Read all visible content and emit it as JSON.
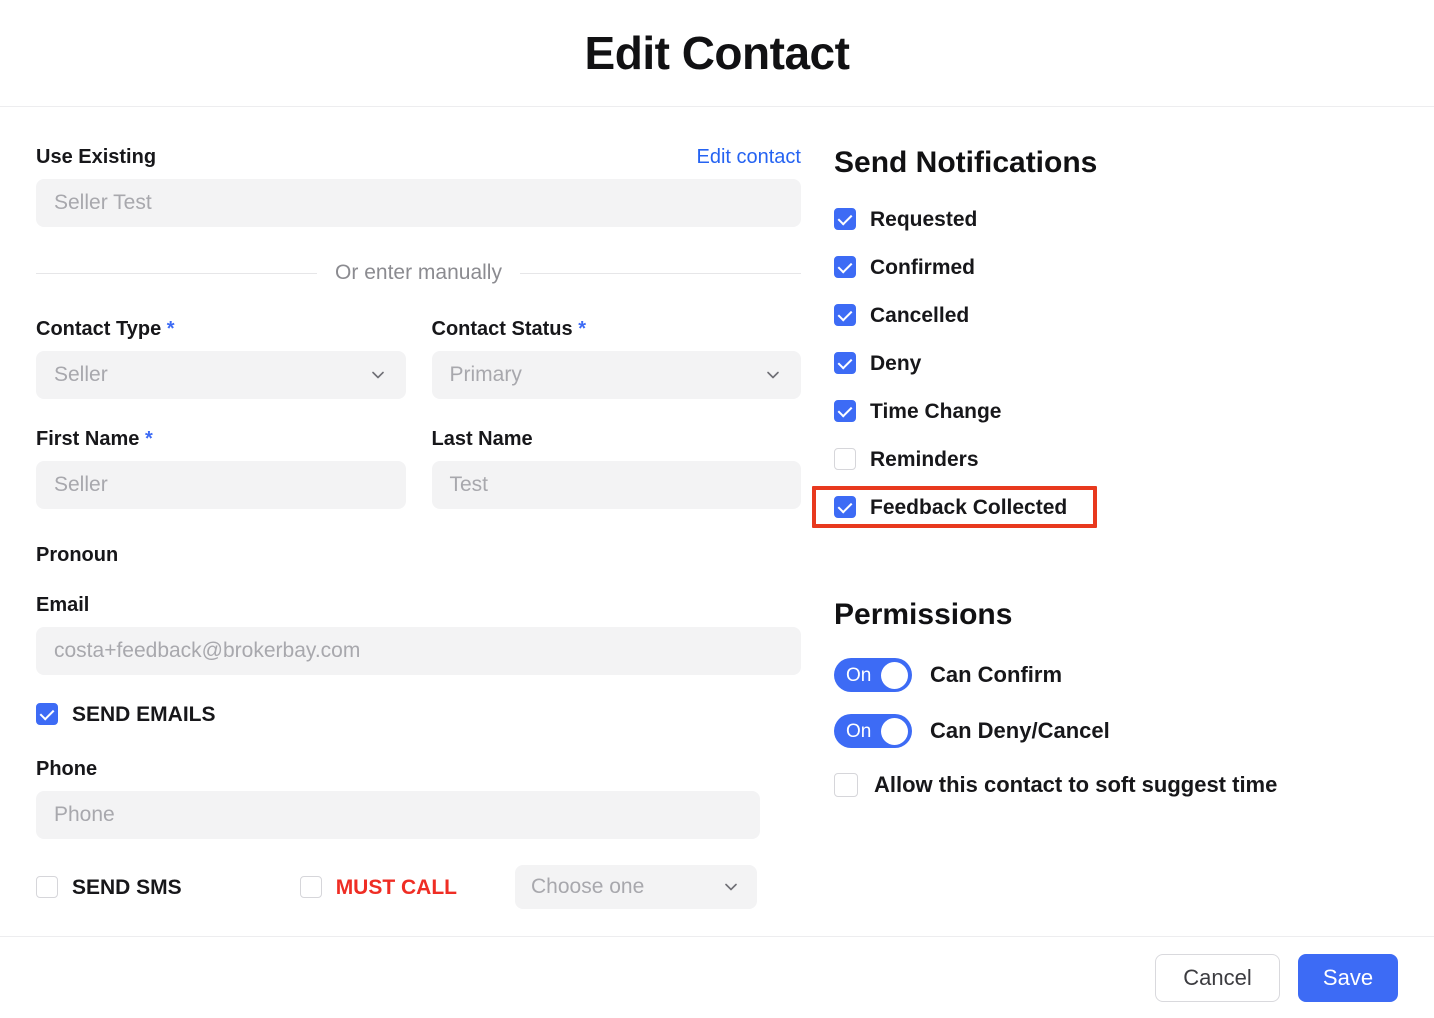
{
  "dialog": {
    "title": "Edit Contact"
  },
  "colors": {
    "accent_blue": "#3d6bf5",
    "link_blue": "#2563f2",
    "highlight_red": "#e8391e",
    "must_call_red": "#ef2d24",
    "input_bg": "#f3f3f4"
  },
  "left": {
    "use_existing": {
      "label": "Use Existing",
      "edit_link": "Edit contact",
      "placeholder": "Seller Test",
      "value": ""
    },
    "divider_text": "Or enter manually",
    "contact_type": {
      "label": "Contact Type",
      "required": "*",
      "placeholder": "Seller",
      "value": ""
    },
    "contact_status": {
      "label": "Contact Status",
      "required": "*",
      "placeholder": "Primary",
      "value": ""
    },
    "first_name": {
      "label": "First Name",
      "required": "*",
      "placeholder": "Seller",
      "value": ""
    },
    "last_name": {
      "label": "Last Name",
      "placeholder": "Test",
      "value": ""
    },
    "pronoun": {
      "label": "Pronoun"
    },
    "email": {
      "label": "Email",
      "placeholder": "costa+feedback@brokerbay.com",
      "value": ""
    },
    "send_emails": {
      "label": "SEND EMAILS",
      "checked": true
    },
    "phone": {
      "label": "Phone",
      "placeholder": "Phone",
      "value": ""
    },
    "send_sms": {
      "label": "SEND SMS",
      "checked": false
    },
    "must_call": {
      "label": "MUST CALL",
      "checked": false
    },
    "must_call_select": {
      "placeholder": "Choose one",
      "value": ""
    }
  },
  "right": {
    "notifications": {
      "title": "Send Notifications",
      "items": [
        {
          "label": "Requested",
          "checked": true,
          "highlighted": false
        },
        {
          "label": "Confirmed",
          "checked": true,
          "highlighted": false
        },
        {
          "label": "Cancelled",
          "checked": true,
          "highlighted": false
        },
        {
          "label": "Deny",
          "checked": true,
          "highlighted": false
        },
        {
          "label": "Time Change",
          "checked": true,
          "highlighted": false
        },
        {
          "label": "Reminders",
          "checked": false,
          "highlighted": false
        },
        {
          "label": "Feedback Collected",
          "checked": true,
          "highlighted": true
        }
      ]
    },
    "permissions": {
      "title": "Permissions",
      "toggles": [
        {
          "label": "Can Confirm",
          "state": "On"
        },
        {
          "label": "Can Deny/Cancel",
          "state": "On"
        }
      ],
      "checkbox": {
        "label": "Allow this contact to soft suggest time",
        "checked": false
      }
    }
  },
  "footer": {
    "cancel_label": "Cancel",
    "save_label": "Save"
  },
  "icons": {
    "chevron_down": "chevron-down-icon"
  }
}
